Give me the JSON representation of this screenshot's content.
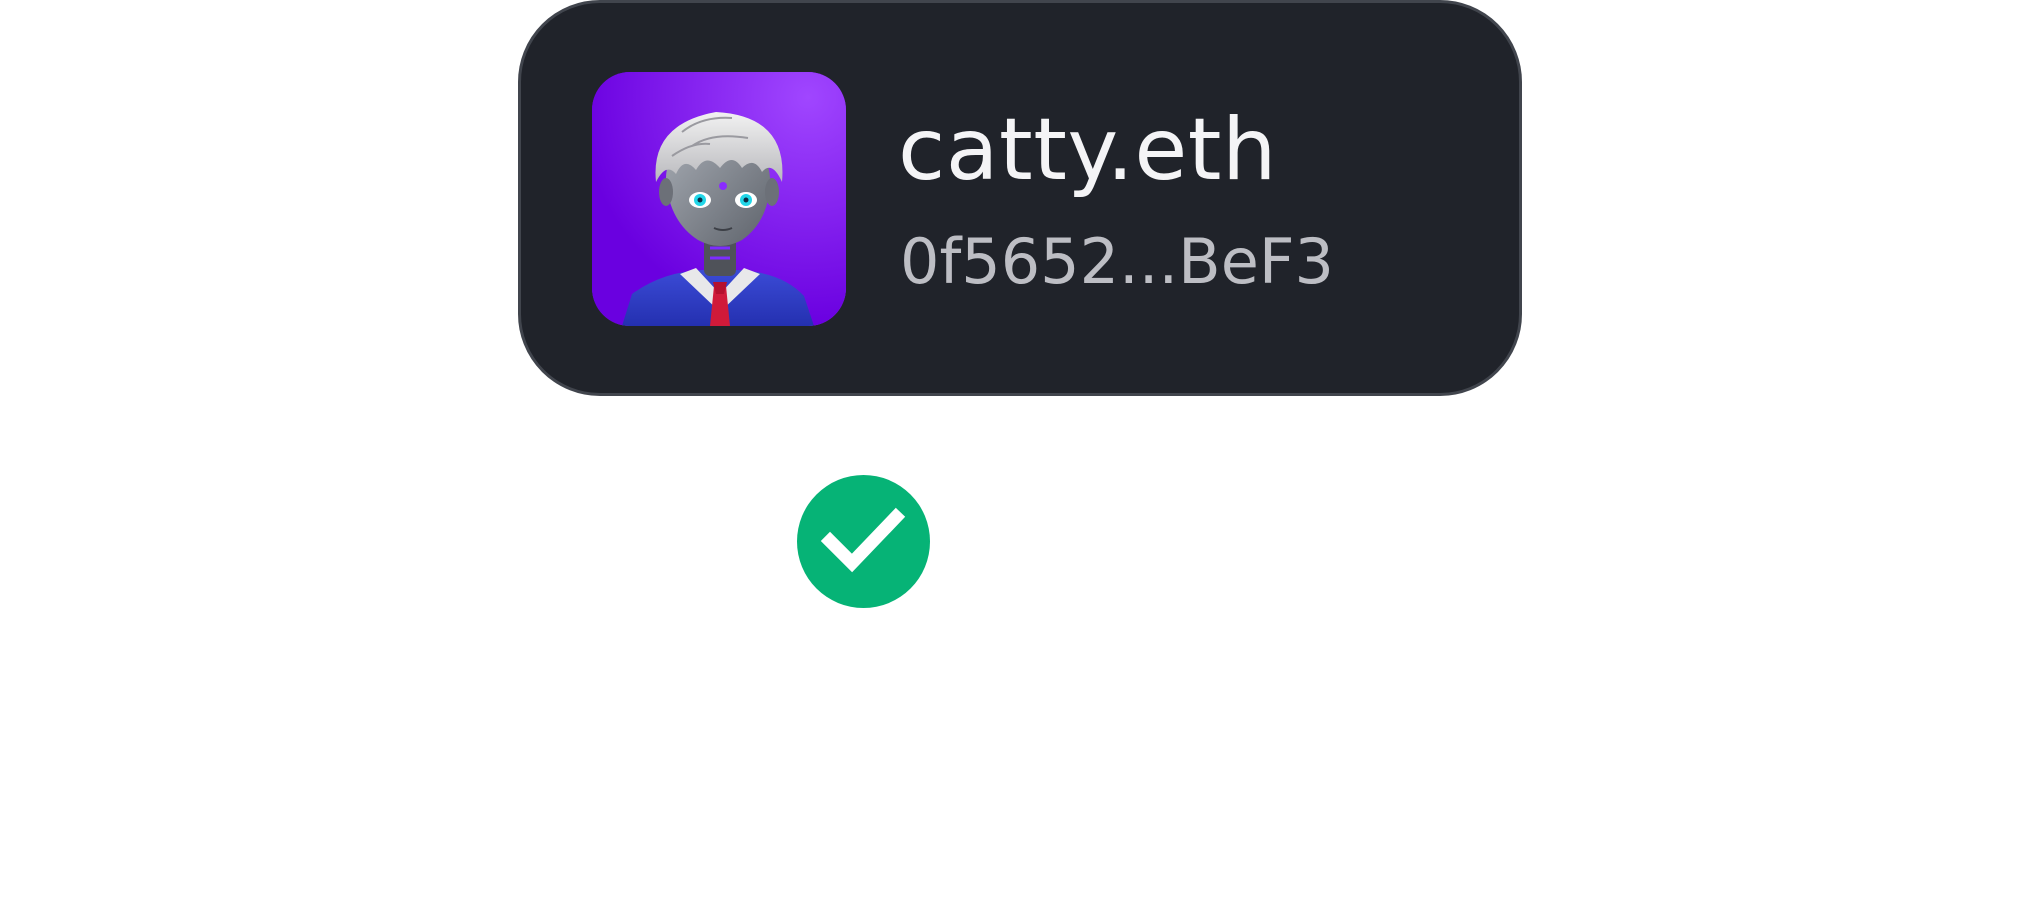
{
  "account": {
    "name": "catty.eth",
    "address": "0f5652...BeF3",
    "avatar_icon": "robot-avatar-nft"
  },
  "status": {
    "icon": "check-circle-icon",
    "color": "#06b376"
  },
  "colors": {
    "card_background": "#20232a",
    "card_border": "#41454d",
    "avatar_background": "#7a0ff0",
    "name_text": "#f4f4f6",
    "address_text": "#bdbec4"
  }
}
